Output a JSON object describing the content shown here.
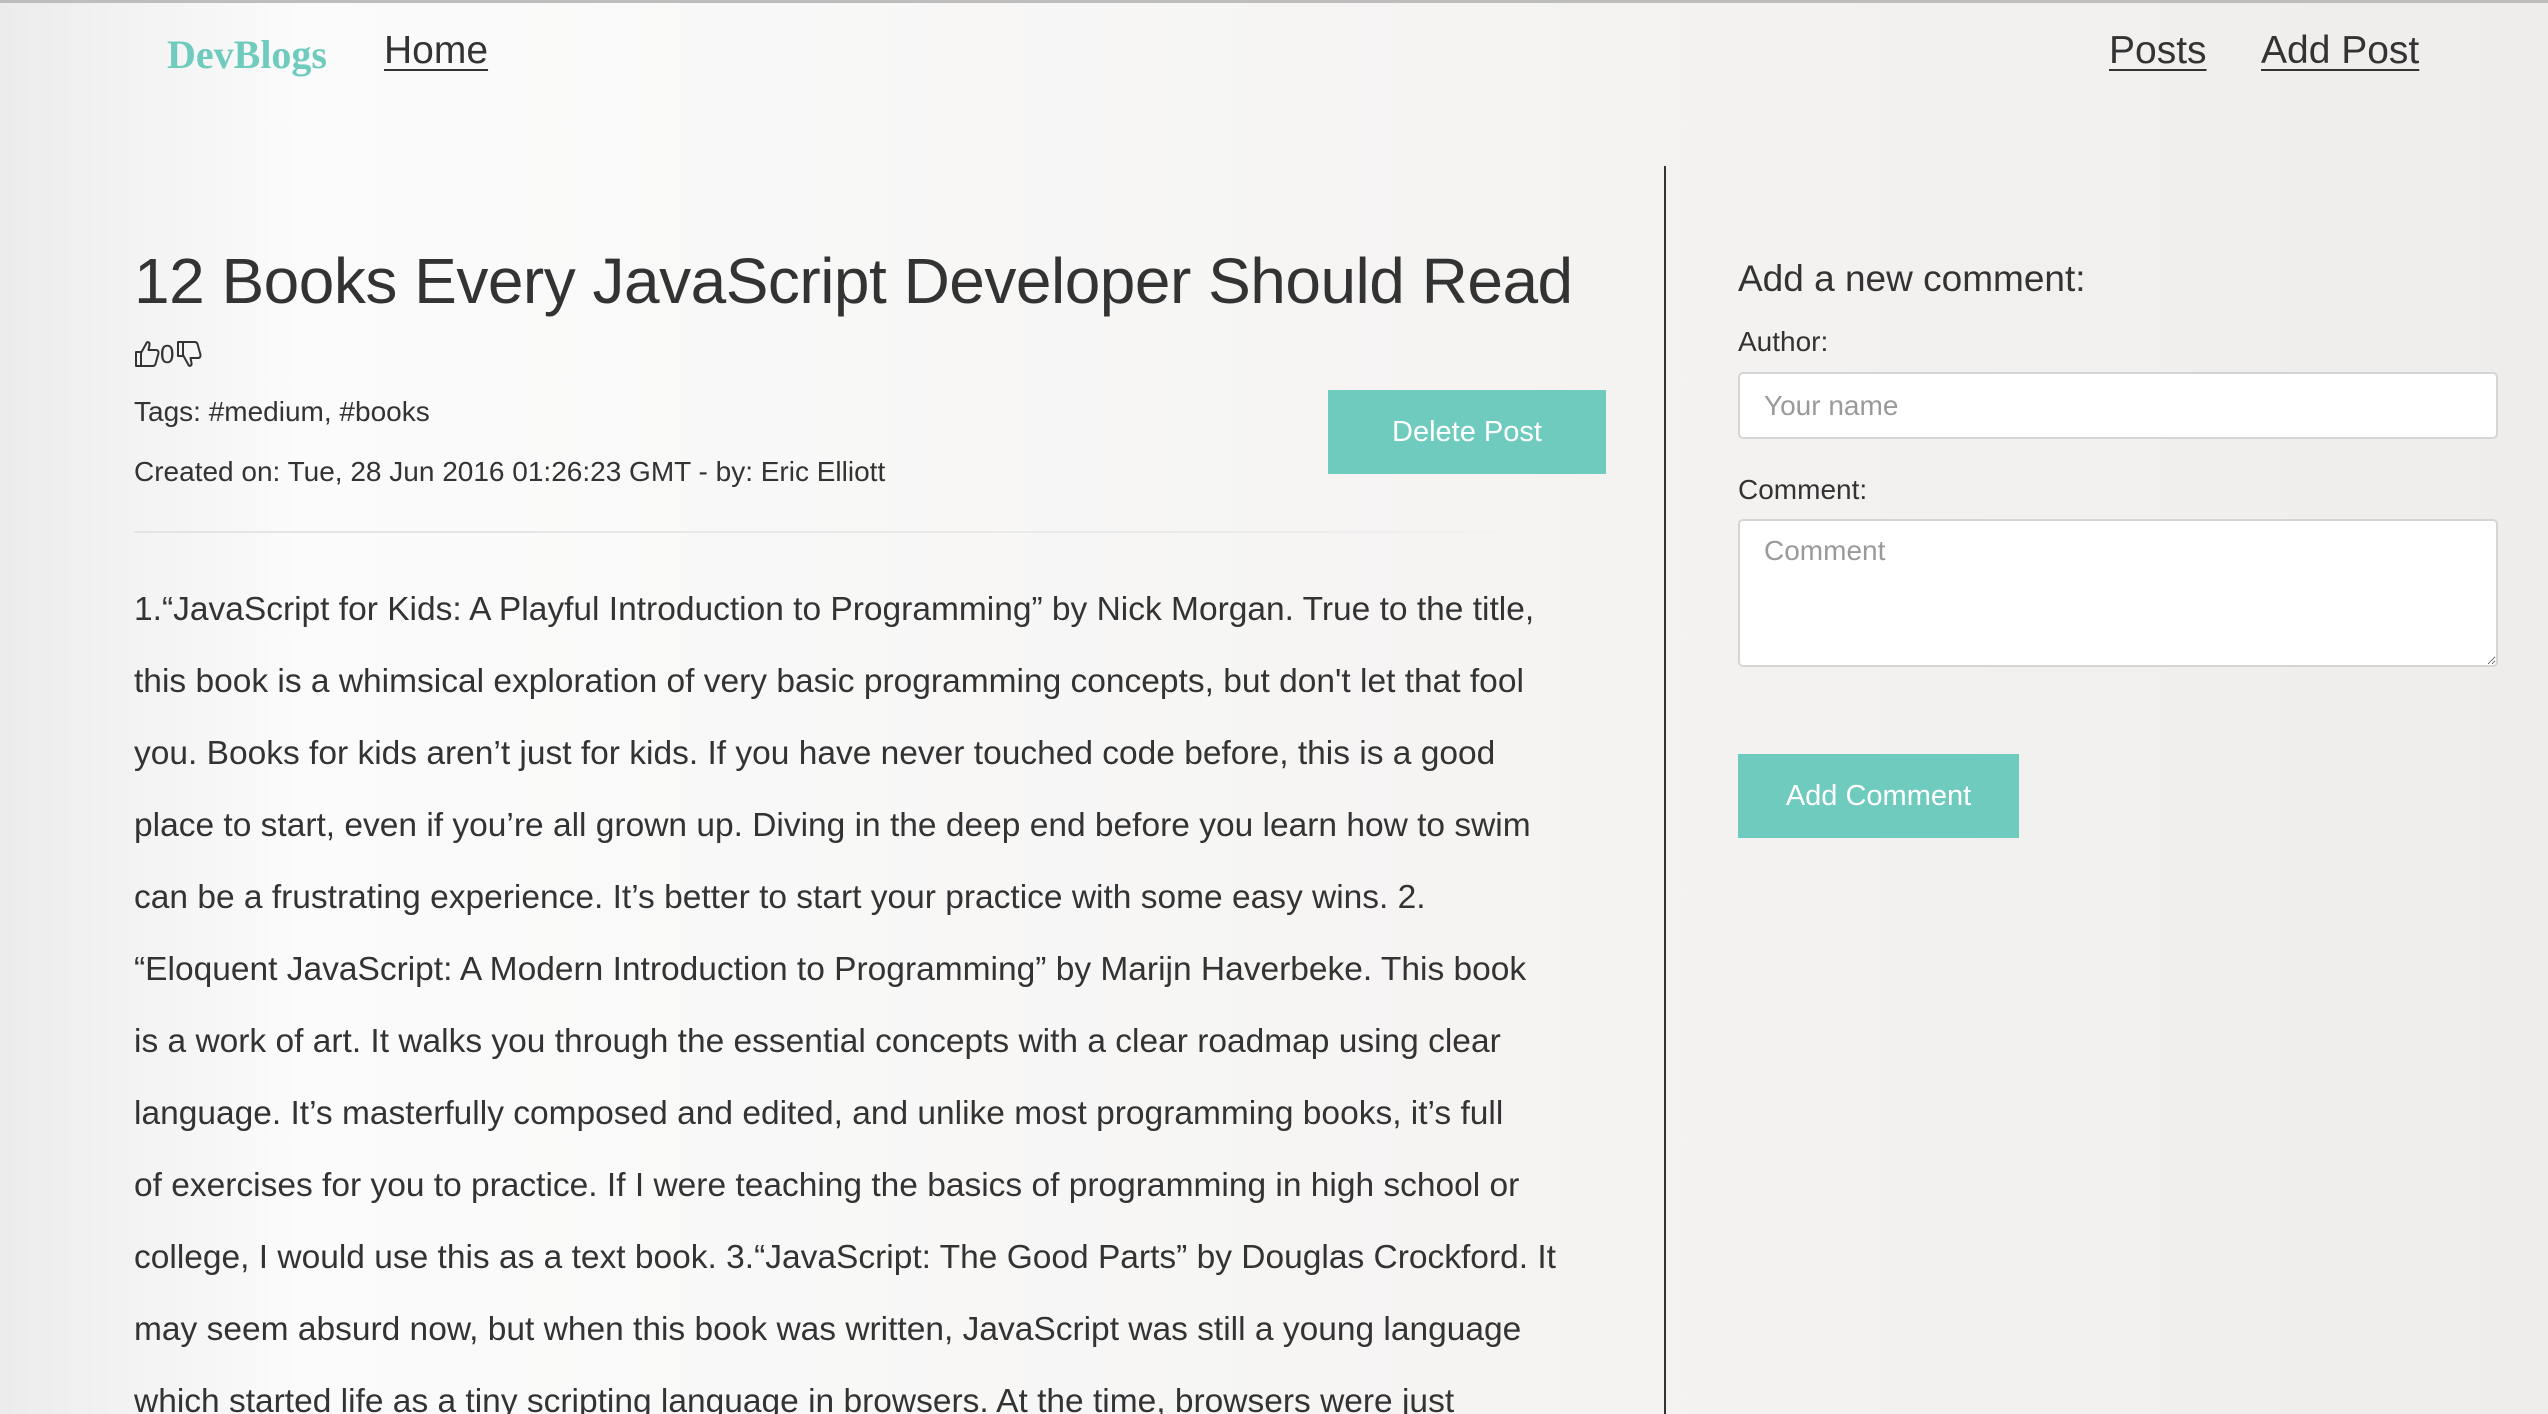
{
  "navbar": {
    "brand": "DevBlogs",
    "home": "Home",
    "posts": "Posts",
    "add_post": "Add Post"
  },
  "post": {
    "title": "12 Books Every JavaScript Developer Should Read",
    "votes": {
      "like_icon": "thumbs-up-icon",
      "count": "0",
      "dislike_icon": "thumbs-down-icon"
    },
    "tags_text": "Tags: #medium, #books",
    "created_text": "Created on: Tue, 28 Jun 2016 01:26:23 GMT - by: Eric Elliott",
    "delete_label": "Delete Post",
    "body_lines": [
      "1.“JavaScript for Kids: A Playful Introduction to Programming” by Nick Morgan. True to the title,",
      "this book is a whimsical exploration of very basic programming concepts, but don't let that fool",
      "you. Books for kids aren’t just for kids. If you have never touched code before, this is a good",
      "place to start, even if you’re all grown up. Diving in the deep end before you learn how to swim",
      "can be a frustrating experience. It’s better to start your practice with some easy wins. 2.",
      "“Eloquent JavaScript: A Modern Introduction to Programming” by Marijn Haverbeke. This book",
      "is a work of art. It walks you through the essential concepts with a clear roadmap using clear",
      "language. It’s masterfully composed and edited, and unlike most programming books, it’s full",
      "of exercises for you to practice. If I were teaching the basics of programming in high school or",
      "college, I would use this as a text book. 3.“JavaScript: The Good Parts” by Douglas Crockford. It",
      "may seem absurd now, but when this book was written, JavaScript was still a young language",
      "which started life as a tiny scripting language in browsers. At the time, browsers were just"
    ]
  },
  "comment_form": {
    "heading": "Add a new comment:",
    "author_label": "Author:",
    "author_placeholder": "Your name",
    "author_value": "",
    "comment_label": "Comment:",
    "comment_placeholder": "Comment",
    "comment_value": "",
    "submit_label": "Add Comment"
  },
  "colors": {
    "accent": "#6fcbbd",
    "text": "#333333",
    "button_text": "#ffffff"
  }
}
